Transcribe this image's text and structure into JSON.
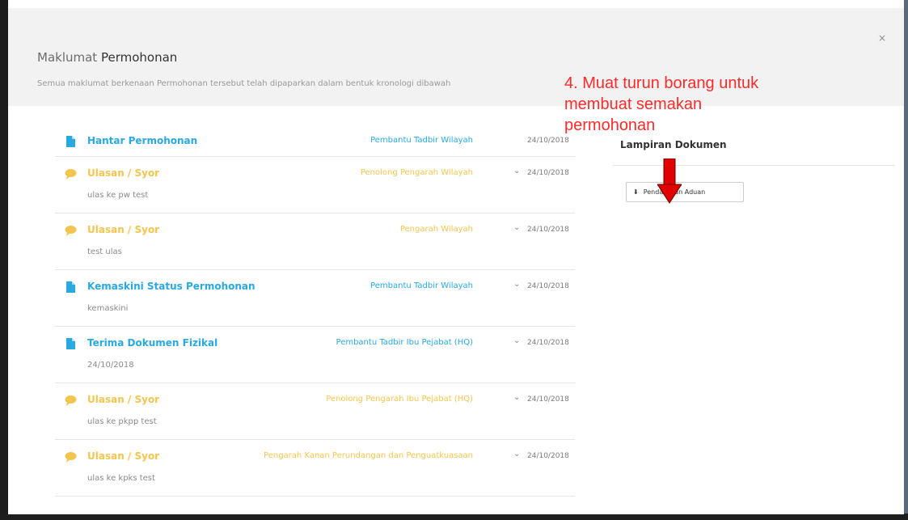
{
  "backdrop": {
    "colors": {
      "overlay": "#3c3c3c"
    }
  },
  "modal": {
    "title_prefix": "Maklumat",
    "title_main": "Permohonan",
    "subtitle": "Semua maklumat berkenaan Permohonan tersebut telah dipaparkan dalam bentuk kronologi dibawah",
    "close_label": "×"
  },
  "timeline": [
    {
      "icon": "document-icon",
      "color": "#29a9e1",
      "title": "Hantar Permohonan",
      "role": "Pembantu Tadbir Wilayah",
      "date": "24/10/2018",
      "note": "",
      "expandable": false
    },
    {
      "icon": "comment-icon",
      "color": "#f4c54e",
      "title": "Ulasan / Syor",
      "role": "Penolong Pengarah Wilayah",
      "date": "24/10/2018",
      "note": "ulas ke pw test",
      "expandable": true
    },
    {
      "icon": "comment-icon",
      "color": "#f4c54e",
      "title": "Ulasan / Syor",
      "role": "Pengarah Wilayah",
      "date": "24/10/2018",
      "note": "test ulas",
      "expandable": true
    },
    {
      "icon": "document-icon",
      "color": "#29a9e1",
      "title": "Kemaskini Status Permohonan",
      "role": "Pembantu Tadbir Wilayah",
      "date": "24/10/2018",
      "note": "kemaskini",
      "expandable": true
    },
    {
      "icon": "document-icon",
      "color": "#29a9e1",
      "title": "Terima Dokumen Fizikal",
      "role": "Pembantu Tadbir Ibu Pejabat (HQ)",
      "date": "24/10/2018",
      "note": "24/10/2018",
      "expandable": true
    },
    {
      "icon": "comment-icon",
      "color": "#f4c54e",
      "title": "Ulasan / Syor",
      "role": "Penolong Pengarah Ibu Pejabat (HQ)",
      "date": "24/10/2018",
      "note": "ulas ke pkpp test",
      "expandable": true
    },
    {
      "icon": "comment-icon",
      "color": "#f4c54e",
      "title": "Ulasan / Syor",
      "role": "Pengarah Kanan Perundangan dan Penguatkuasaan",
      "date": "24/10/2018",
      "note": "ulas ke kpks test",
      "expandable": true
    }
  ],
  "lampiran": {
    "title": "Lampiran Dokumen",
    "button_label": "Pendaftaran Aduan",
    "button_icon": "download-icon"
  },
  "annotation": {
    "text_line1": "4. Muat turun borang untuk",
    "text_line2": "membuat semakan",
    "text_line3": "permohonan",
    "color": "#ff2a2a",
    "arrow_icon": "red-down-arrow-icon"
  }
}
